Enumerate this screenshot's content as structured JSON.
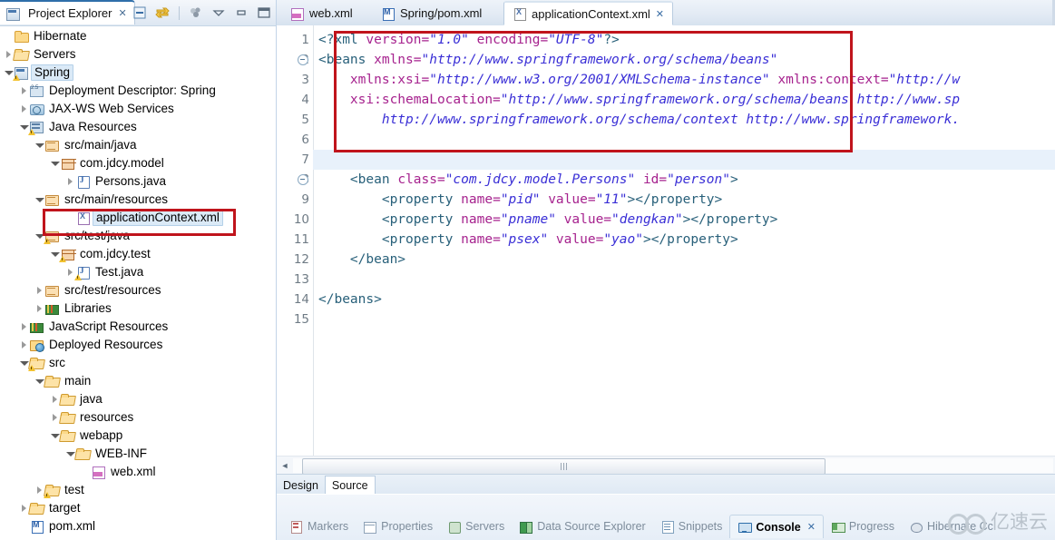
{
  "explorer": {
    "title": "Project Explorer",
    "close_label": "✕",
    "toolbar": [
      {
        "name": "collapse-all-icon",
        "label": ""
      },
      {
        "name": "link-with-editor-icon",
        "label": ""
      },
      {
        "name": "view-menu-icon",
        "label": ""
      },
      {
        "name": "view-menu-chevron-icon",
        "label": ""
      },
      {
        "name": "minimize-icon",
        "label": ""
      },
      {
        "name": "maximize-icon",
        "label": ""
      }
    ],
    "tree": [
      {
        "label": "Hibernate",
        "indent": 1,
        "arrow": "none",
        "icon": "folder",
        "warn": false,
        "selected": false
      },
      {
        "label": "Servers",
        "indent": 1,
        "arrow": "closed",
        "icon": "folder-open",
        "warn": false,
        "selected": false
      },
      {
        "label": "Spring",
        "indent": 1,
        "arrow": "open",
        "icon": "proj",
        "warn": true,
        "selected": true
      },
      {
        "label": "Deployment Descriptor: Spring",
        "indent": 2,
        "arrow": "closed",
        "icon": "descr",
        "warn": false,
        "selected": false
      },
      {
        "label": "JAX-WS Web Services",
        "indent": 2,
        "arrow": "closed",
        "icon": "jaxws",
        "warn": false,
        "selected": false
      },
      {
        "label": "Java Resources",
        "indent": 2,
        "arrow": "open",
        "icon": "jres",
        "warn": true,
        "selected": false
      },
      {
        "label": "src/main/java",
        "indent": 3,
        "arrow": "open",
        "icon": "srcfolder",
        "warn": false,
        "selected": false
      },
      {
        "label": "com.jdcy.model",
        "indent": 4,
        "arrow": "open",
        "icon": "pkg",
        "warn": false,
        "selected": false
      },
      {
        "label": "Persons.java",
        "indent": 5,
        "arrow": "closed",
        "icon": "java",
        "warn": false,
        "selected": false
      },
      {
        "label": "src/main/resources",
        "indent": 3,
        "arrow": "open",
        "icon": "srcfolder",
        "warn": false,
        "selected": false
      },
      {
        "label": "applicationContext.xml",
        "indent": 5,
        "arrow": "none",
        "icon": "xmlf",
        "warn": false,
        "selected": true
      },
      {
        "label": "src/test/java",
        "indent": 3,
        "arrow": "open",
        "icon": "srcfolder",
        "warn": true,
        "selected": false
      },
      {
        "label": "com.jdcy.test",
        "indent": 4,
        "arrow": "open",
        "icon": "pkg",
        "warn": true,
        "selected": false
      },
      {
        "label": "Test.java",
        "indent": 5,
        "arrow": "closed",
        "icon": "java",
        "warn": true,
        "selected": false
      },
      {
        "label": "src/test/resources",
        "indent": 3,
        "arrow": "closed",
        "icon": "srcfolder",
        "warn": false,
        "selected": false
      },
      {
        "label": "Libraries",
        "indent": 3,
        "arrow": "closed",
        "icon": "books",
        "warn": false,
        "selected": false
      },
      {
        "label": "JavaScript Resources",
        "indent": 2,
        "arrow": "closed",
        "icon": "books",
        "warn": false,
        "selected": false
      },
      {
        "label": "Deployed Resources",
        "indent": 2,
        "arrow": "closed",
        "icon": "deploy",
        "warn": false,
        "selected": false
      },
      {
        "label": "src",
        "indent": 2,
        "arrow": "open",
        "icon": "folder-open",
        "warn": true,
        "selected": false
      },
      {
        "label": "main",
        "indent": 3,
        "arrow": "open",
        "icon": "folder-open",
        "warn": false,
        "selected": false
      },
      {
        "label": "java",
        "indent": 4,
        "arrow": "closed",
        "icon": "folder-open",
        "warn": false,
        "selected": false
      },
      {
        "label": "resources",
        "indent": 4,
        "arrow": "closed",
        "icon": "folder-open",
        "warn": false,
        "selected": false
      },
      {
        "label": "webapp",
        "indent": 4,
        "arrow": "open",
        "icon": "folder-open",
        "warn": false,
        "selected": false
      },
      {
        "label": "WEB-INF",
        "indent": 5,
        "arrow": "open",
        "icon": "folder-open",
        "warn": false,
        "selected": false
      },
      {
        "label": "web.xml",
        "indent": 6,
        "arrow": "none",
        "icon": "webxml",
        "warn": false,
        "selected": false
      },
      {
        "label": "test",
        "indent": 3,
        "arrow": "closed",
        "icon": "folder-open",
        "warn": true,
        "selected": false
      },
      {
        "label": "target",
        "indent": 2,
        "arrow": "closed",
        "icon": "folder-open",
        "warn": false,
        "selected": false
      },
      {
        "label": "pom.xml",
        "indent": 2,
        "arrow": "none",
        "icon": "pom",
        "warn": false,
        "selected": false
      }
    ]
  },
  "editor": {
    "tabs": [
      {
        "label": "web.xml",
        "icon": "xml-file-icon",
        "active": false,
        "close": ""
      },
      {
        "label": "Spring/pom.xml",
        "icon": "maven-pom-icon",
        "active": false,
        "close": ""
      },
      {
        "label": "applicationContext.xml",
        "icon": "xml-file-icon",
        "active": true,
        "close": "✕"
      }
    ],
    "lines": [
      {
        "n": "1",
        "fold": false,
        "current": false,
        "indent": 0,
        "spans": [
          {
            "t": "tag",
            "v": "<?xml "
          },
          {
            "t": "attr",
            "v": "version="
          },
          {
            "t": "val",
            "v": "\"1.0\""
          },
          {
            "t": "attr",
            "v": " encoding="
          },
          {
            "t": "val",
            "v": "\"UTF-8\""
          },
          {
            "t": "tag",
            "v": "?>"
          }
        ]
      },
      {
        "n": "2",
        "fold": true,
        "current": false,
        "indent": 0,
        "spans": [
          {
            "t": "tag",
            "v": "<beans "
          },
          {
            "t": "attr",
            "v": "xmlns="
          },
          {
            "t": "val",
            "v": "\"http://www.springframework.org/schema/beans\""
          }
        ]
      },
      {
        "n": "3",
        "fold": false,
        "current": false,
        "indent": 0,
        "spans": [
          {
            "t": "plain",
            "v": "    "
          },
          {
            "t": "attr",
            "v": "xmlns:xsi="
          },
          {
            "t": "val",
            "v": "\"http://www.w3.org/2001/XMLSchema-instance\""
          },
          {
            "t": "attr",
            "v": " xmlns:context="
          },
          {
            "t": "val",
            "v": "\"http://w"
          }
        ]
      },
      {
        "n": "4",
        "fold": false,
        "current": false,
        "indent": 0,
        "spans": [
          {
            "t": "plain",
            "v": "    "
          },
          {
            "t": "attr",
            "v": "xsi:schemaLocation="
          },
          {
            "t": "val",
            "v": "\"http://www.springframework.org/schema/beans http://www.sp"
          }
        ]
      },
      {
        "n": "5",
        "fold": false,
        "current": false,
        "indent": 0,
        "spans": [
          {
            "t": "plain",
            "v": "        "
          },
          {
            "t": "val",
            "v": "http://www.springframework.org/schema/context http://www.springframework."
          }
        ]
      },
      {
        "n": "6",
        "fold": false,
        "current": false,
        "indent": 0,
        "spans": []
      },
      {
        "n": "7",
        "fold": false,
        "current": true,
        "indent": 0,
        "spans": []
      },
      {
        "n": "8",
        "fold": true,
        "current": false,
        "indent": 0,
        "spans": [
          {
            "t": "plain",
            "v": "    "
          },
          {
            "t": "tag",
            "v": "<bean "
          },
          {
            "t": "attr",
            "v": "class="
          },
          {
            "t": "val",
            "v": "\"com.jdcy.model.Persons\""
          },
          {
            "t": "attr",
            "v": " id="
          },
          {
            "t": "val",
            "v": "\"person\""
          },
          {
            "t": "tag",
            "v": ">"
          }
        ]
      },
      {
        "n": "9",
        "fold": false,
        "current": false,
        "indent": 0,
        "spans": [
          {
            "t": "plain",
            "v": "        "
          },
          {
            "t": "tag",
            "v": "<property "
          },
          {
            "t": "attr",
            "v": "name="
          },
          {
            "t": "val",
            "v": "\"pid\""
          },
          {
            "t": "attr",
            "v": " value="
          },
          {
            "t": "val",
            "v": "\"11\""
          },
          {
            "t": "tag",
            "v": "></property>"
          }
        ]
      },
      {
        "n": "10",
        "fold": false,
        "current": false,
        "indent": 0,
        "spans": [
          {
            "t": "plain",
            "v": "        "
          },
          {
            "t": "tag",
            "v": "<property "
          },
          {
            "t": "attr",
            "v": "name="
          },
          {
            "t": "val",
            "v": "\"pname\""
          },
          {
            "t": "attr",
            "v": " value="
          },
          {
            "t": "val",
            "v": "\"dengkan\""
          },
          {
            "t": "tag",
            "v": "></property>"
          }
        ]
      },
      {
        "n": "11",
        "fold": false,
        "current": false,
        "indent": 0,
        "spans": [
          {
            "t": "plain",
            "v": "        "
          },
          {
            "t": "tag",
            "v": "<property "
          },
          {
            "t": "attr",
            "v": "name="
          },
          {
            "t": "val",
            "v": "\"psex\""
          },
          {
            "t": "attr",
            "v": " value="
          },
          {
            "t": "val",
            "v": "\"yao\""
          },
          {
            "t": "tag",
            "v": "></property>"
          }
        ]
      },
      {
        "n": "12",
        "fold": false,
        "current": false,
        "indent": 0,
        "spans": [
          {
            "t": "plain",
            "v": "    "
          },
          {
            "t": "tag",
            "v": "</bean>"
          }
        ]
      },
      {
        "n": "13",
        "fold": false,
        "current": false,
        "indent": 0,
        "spans": []
      },
      {
        "n": "14",
        "fold": false,
        "current": false,
        "indent": 0,
        "spans": [
          {
            "t": "tag",
            "v": "</beans>"
          }
        ]
      },
      {
        "n": "15",
        "fold": false,
        "current": false,
        "indent": 0,
        "spans": []
      }
    ],
    "design_source_tabs": [
      {
        "label": "Design",
        "active": false
      },
      {
        "label": "Source",
        "active": true
      }
    ]
  },
  "bottom_view_tabs": [
    {
      "label": "Markers",
      "icon": "markers-icon",
      "active": false,
      "close": ""
    },
    {
      "label": "Properties",
      "icon": "properties-icon",
      "active": false,
      "close": ""
    },
    {
      "label": "Servers",
      "icon": "servers-icon",
      "active": false,
      "close": ""
    },
    {
      "label": "Data Source Explorer",
      "icon": "database-icon",
      "active": false,
      "close": ""
    },
    {
      "label": "Snippets",
      "icon": "snippets-icon",
      "active": false,
      "close": ""
    },
    {
      "label": "Console",
      "icon": "console-icon",
      "active": true,
      "close": "✕"
    },
    {
      "label": "Progress",
      "icon": "progress-icon",
      "active": false,
      "close": ""
    },
    {
      "label": "Hibernate Cc",
      "icon": "hibernate-icon",
      "active": false,
      "close": ""
    }
  ],
  "watermark": {
    "text": "亿速云"
  },
  "colors": {
    "annotation_red": "#c0141c",
    "tag": "#28607a",
    "attribute": "#a6228e",
    "value": "#3a2fd6",
    "current_line": "#e8f1fb",
    "selection": "#dbeaf7"
  }
}
